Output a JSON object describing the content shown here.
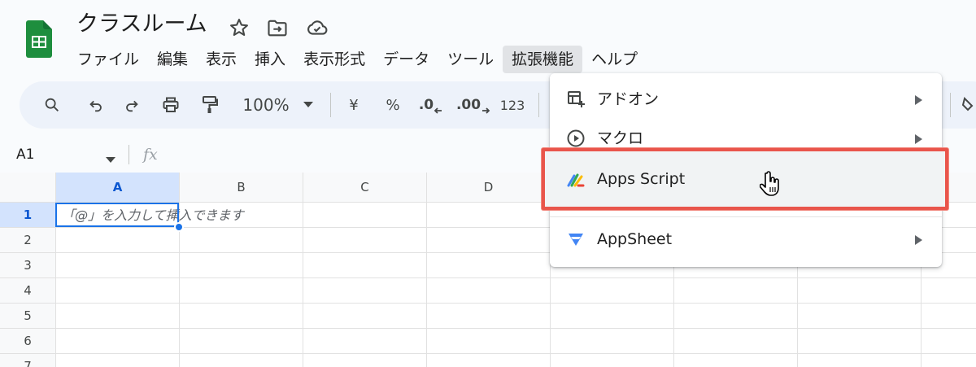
{
  "header": {
    "title": "クラスルーム",
    "menu": [
      "ファイル",
      "編集",
      "表示",
      "挿入",
      "表示形式",
      "データ",
      "ツール",
      "拡張機能",
      "ヘルプ"
    ],
    "active_menu_index": 7
  },
  "toolbar": {
    "zoom": "100%",
    "currency": "¥",
    "percent": "%",
    "decrease_decimal": ".0",
    "increase_decimal": ".00",
    "number_format": "123"
  },
  "formula_bar": {
    "name_box": "A1",
    "fx_label": "fx"
  },
  "grid": {
    "columns": [
      "A",
      "B",
      "C",
      "D"
    ],
    "rows": [
      "1",
      "2",
      "3",
      "4",
      "5",
      "6",
      "7"
    ],
    "selected_cell": "A1",
    "cell_hint": "「@」を入力して挿入できます"
  },
  "dropdown": {
    "items": [
      {
        "label": "アドオン",
        "icon": "addons-icon",
        "has_submenu": true
      },
      {
        "label": "マクロ",
        "icon": "play-circle-icon",
        "has_submenu": true
      },
      {
        "label": "Apps Script",
        "icon": "apps-script-icon",
        "has_submenu": false,
        "highlighted": true
      },
      {
        "label": "AppSheet",
        "icon": "appsheet-icon",
        "has_submenu": true
      }
    ]
  },
  "colors": {
    "accent": "#1a73e8",
    "highlight_border": "#e9554b",
    "sheets_green": "#1e8e3e"
  }
}
